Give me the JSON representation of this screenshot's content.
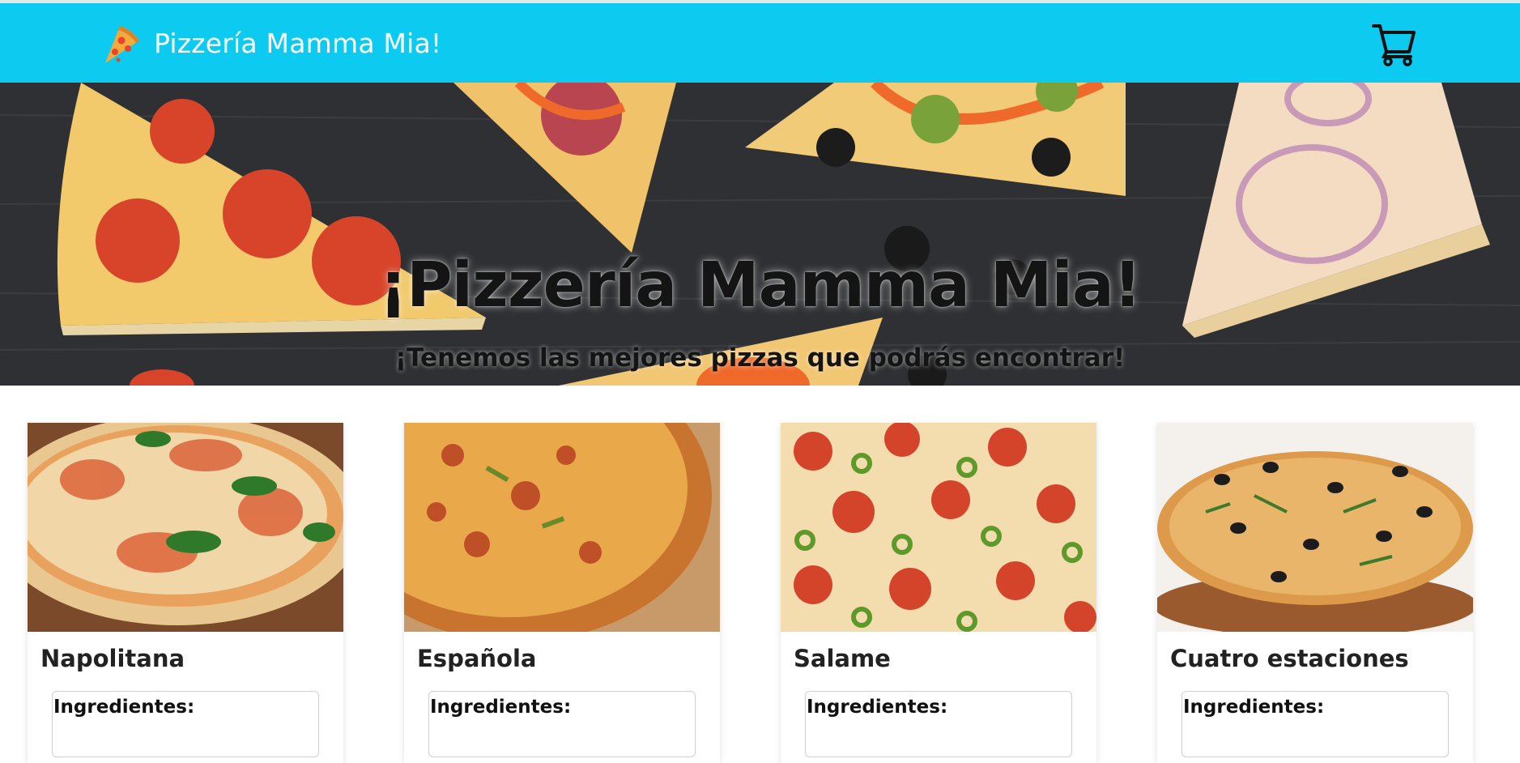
{
  "navbar": {
    "brand_text": "Pizzería Mamma Mia!",
    "brand_icon": "pizza-slice-icon",
    "cart_icon": "shopping-cart-icon",
    "background_color": "#0dcaf0"
  },
  "hero": {
    "title": "¡Pizzería Mamma Mia!",
    "subtitle": "¡Tenemos las mejores pizzas que podrás encontrar!"
  },
  "pizzas": [
    {
      "name": "Napolitana",
      "ingredients_label": "Ingredientes:"
    },
    {
      "name": "Española",
      "ingredients_label": "Ingredientes:"
    },
    {
      "name": "Salame",
      "ingredients_label": "Ingredientes:"
    },
    {
      "name": "Cuatro estaciones",
      "ingredients_label": "Ingredientes:"
    }
  ]
}
